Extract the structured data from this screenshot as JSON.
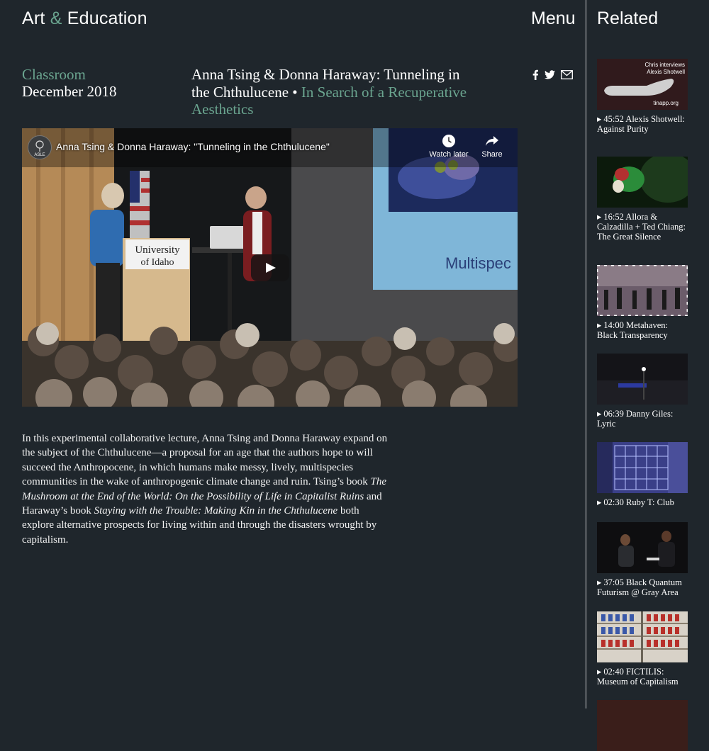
{
  "header": {
    "logo_art": "Art",
    "logo_amp": "&",
    "logo_education": "Education",
    "menu_label": "Menu"
  },
  "article": {
    "category": "Classroom",
    "date": "December 2018",
    "title": "Anna Tsing & Donna Haraway: Tunneling in the Chthulucene",
    "separator": "•",
    "series": "In Search of a Recuperative Aesthetics"
  },
  "share_icons": [
    "facebook-icon",
    "twitter-icon",
    "mail-icon"
  ],
  "video": {
    "title": "Anna Tsing & Donna Haraway: \"Tunneling in the Chthulucene\"",
    "channel_badge": "ASLE",
    "watch_later": "Watch later",
    "share": "Share",
    "podium_line1": "University",
    "podium_line2": "of Idaho",
    "slide_text": "Multispec"
  },
  "description": {
    "part1": "In this experimental collaborative lecture, Anna Tsing and Donna Haraway expand on the subject of the Chthulucene—a proposal for an age that the authors hope to will succeed the Anthropocene, in which humans make messy, lively, multispecies communities in the wake of anthropogenic climate change and ruin. Tsing’s book ",
    "book1": "The Mushroom at the End of the World: On the Possibility of Life in Capitalist Ruins",
    "part2": " and Haraway’s book ",
    "book2": "Staying with the Trouble: Making Kin in the Chthulucene",
    "part3": " both explore alternative prospects for living within and through the disasters wrought by capitalism."
  },
  "sidebar": {
    "title": "Related",
    "items": [
      {
        "caption": "▸ 45:52 Alexis Shotwell: Against Purity",
        "thumb_line1": "Chris interviews",
        "thumb_line2": "Alexis Shotwell",
        "thumb_url": "tinapp.org"
      },
      {
        "caption": "▸ 16:52 Allora & Calzadilla + Ted Chiang: The Great Silence"
      },
      {
        "caption": "▸ 14:00 Metahaven: Black Transparency"
      },
      {
        "caption": "▸ 06:39 Danny Giles: Lyric"
      },
      {
        "caption": "▸ 02:30 Ruby T: Club"
      },
      {
        "caption": "▸ 37:05 Black Quantum Futurism @ Gray Area"
      },
      {
        "caption": "▸ 02:40 FICTILIS: Museum of Capitalism"
      }
    ]
  },
  "colors": {
    "background": "#1f262c",
    "accent": "#6aa48f",
    "divider": "#c9ccce"
  }
}
